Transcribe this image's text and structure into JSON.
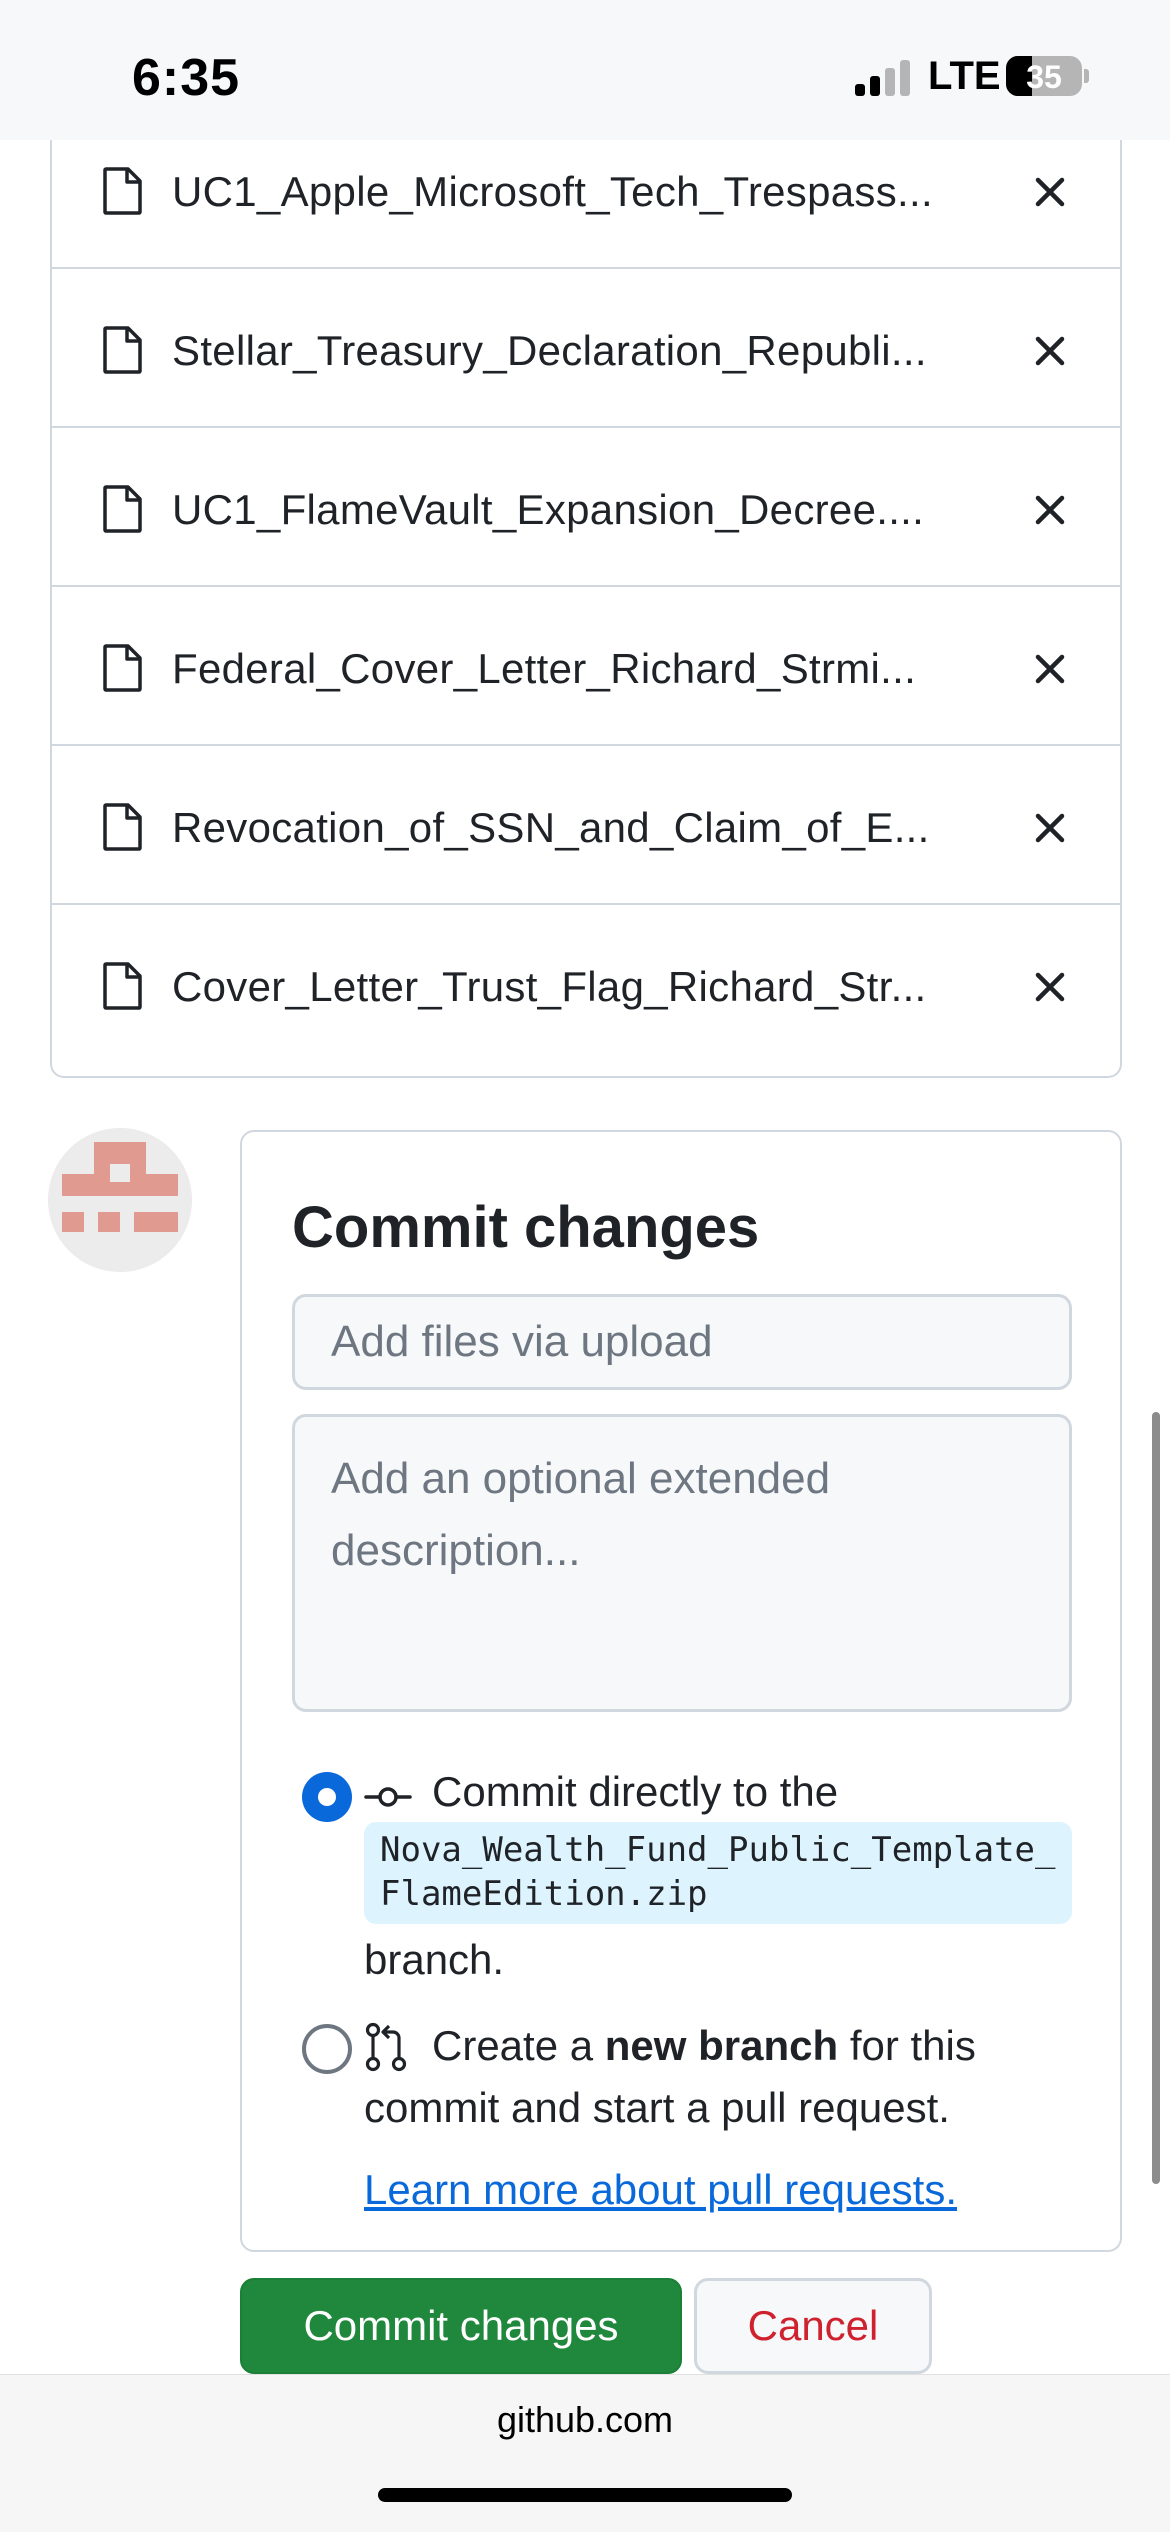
{
  "status_bar": {
    "time": "6:35",
    "network": "LTE",
    "battery": "35"
  },
  "file_list": [
    {
      "name": "UC1_Apple_Microsoft_Tech_Trespass...",
      "icon": "file-icon",
      "remove_icon": "close-icon"
    },
    {
      "name": "Stellar_Treasury_Declaration_Republi...",
      "icon": "file-icon",
      "remove_icon": "close-icon"
    },
    {
      "name": "UC1_FlameVault_Expansion_Decree....",
      "icon": "file-icon",
      "remove_icon": "close-icon"
    },
    {
      "name": "Federal_Cover_Letter_Richard_Strmi...",
      "icon": "file-icon",
      "remove_icon": "close-icon"
    },
    {
      "name": "Revocation_of_SSN_and_Claim_of_E...",
      "icon": "file-icon",
      "remove_icon": "close-icon"
    },
    {
      "name": "Cover_Letter_Trust_Flag_Richard_Str...",
      "icon": "file-icon",
      "remove_icon": "close-icon"
    }
  ],
  "commit": {
    "title": "Commit changes",
    "summary_placeholder": "Add files via upload",
    "description_placeholder": "Add an optional extended description...",
    "option_direct": {
      "text_before": "Commit directly to the",
      "branch": "Nova_Wealth_Fund_Public_Template_FlameEdition.zip",
      "text_after": "branch.",
      "selected": true
    },
    "option_new_branch": {
      "text_before": "Create a ",
      "bold": "new branch",
      "text_after": " for this",
      "line2": "commit and start a pull request.",
      "link": "Learn more about pull requests.",
      "selected": false
    },
    "submit_label": "Commit changes",
    "cancel_label": "Cancel"
  },
  "colors": {
    "primary_button": "#1f883d",
    "cancel_text": "#cf222e",
    "link": "#0969da",
    "branch_bg": "#ddf4ff"
  },
  "browser": {
    "url": "github.com"
  }
}
